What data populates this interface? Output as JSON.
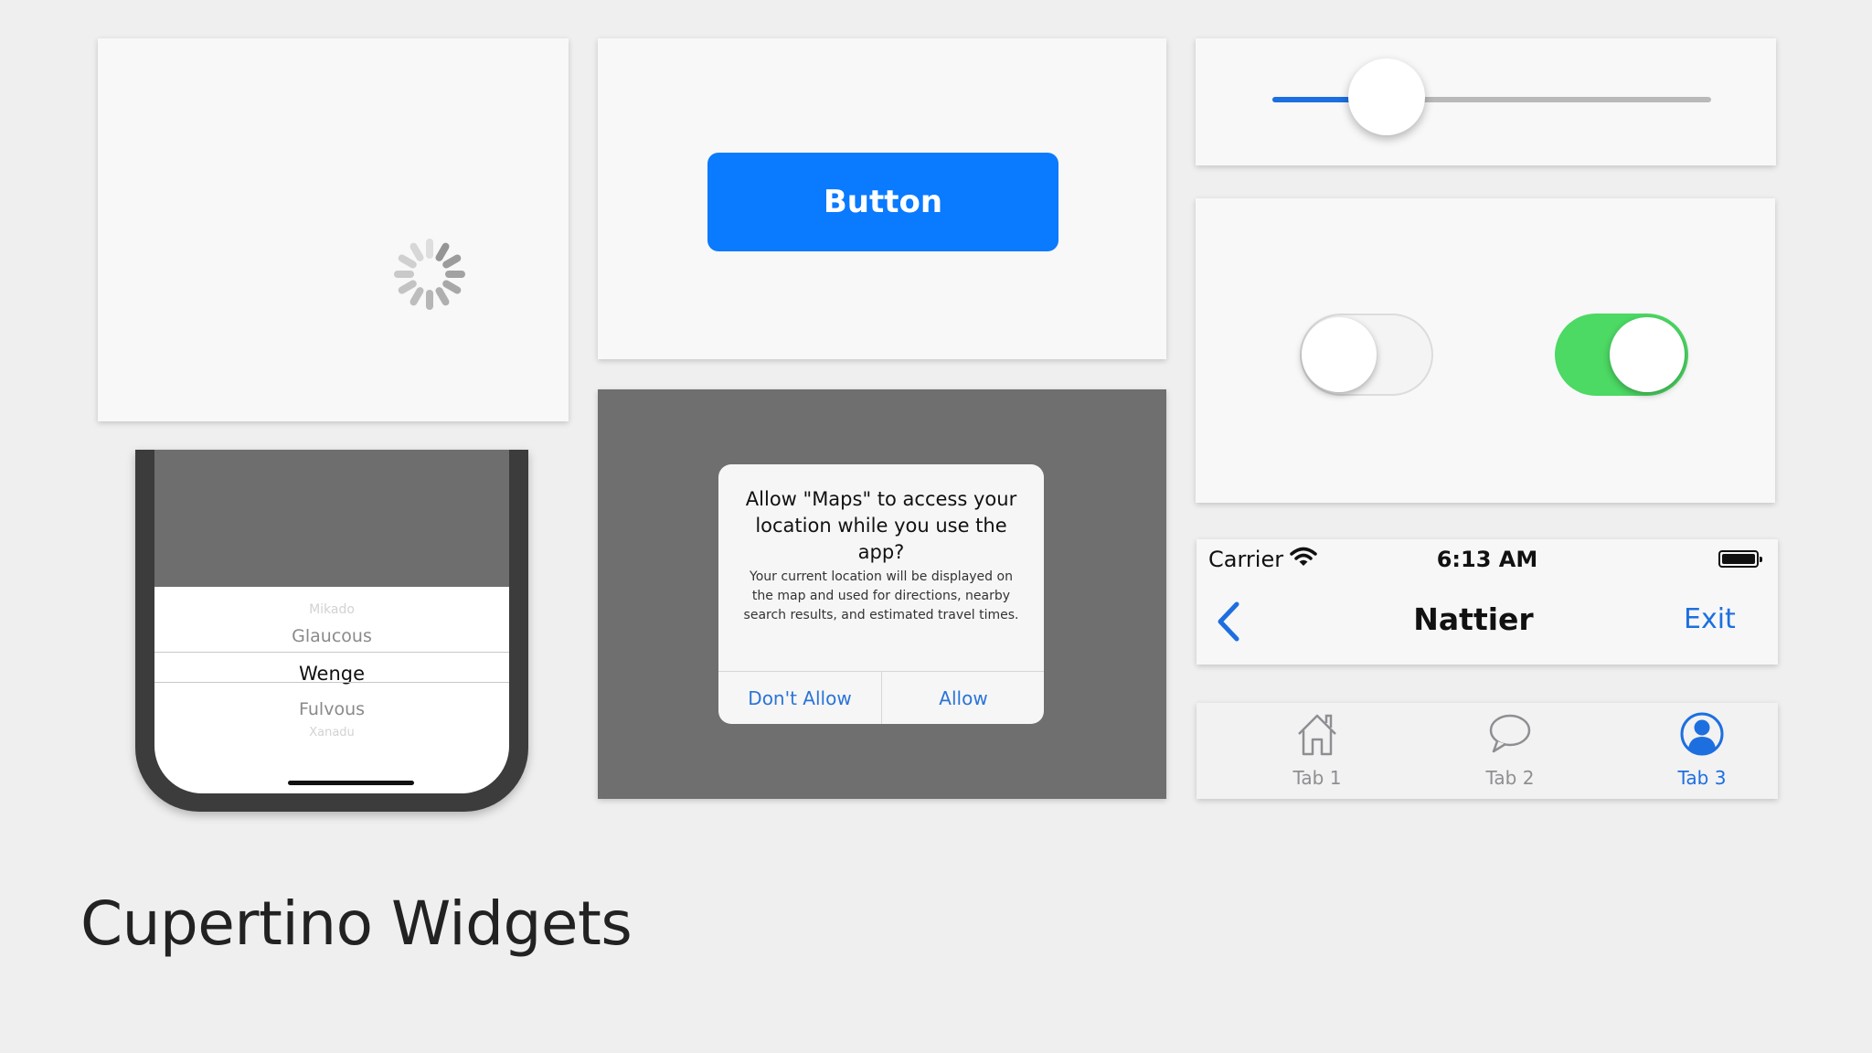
{
  "page": {
    "title": "Cupertino Widgets"
  },
  "activity_indicator": {
    "tick_count": 12
  },
  "button": {
    "label": "Button",
    "color": "#0a7aff"
  },
  "slider": {
    "value": 0.26,
    "active_color": "#1b6fe0",
    "inactive_color": "#b9b9b9"
  },
  "switches": [
    {
      "name": "switch-off",
      "on": false
    },
    {
      "name": "switch-on",
      "on": true,
      "color": "#4cd964"
    }
  ],
  "picker": {
    "items": [
      "Mikado",
      "Glaucous",
      "Wenge",
      "Fulvous",
      "Xanadu"
    ],
    "selected": "Wenge"
  },
  "alert": {
    "title": "Allow \"Maps\" to access your location while you use the app?",
    "message": "Your current location will be displayed on the map and used for directions, nearby search results, and estimated travel times.",
    "cancel_label": "Don't Allow",
    "confirm_label": "Allow",
    "action_color": "#2a74d8"
  },
  "nav_bar": {
    "carrier": "Carrier",
    "time": "6:13 AM",
    "title": "Nattier",
    "trailing_label": "Exit",
    "back_icon": "chevron-left-icon",
    "tint": "#1d6fe0"
  },
  "tab_bar": {
    "tabs": [
      {
        "label": "Tab 1",
        "icon": "house-icon",
        "active": false
      },
      {
        "label": "Tab 2",
        "icon": "chat-bubble-icon",
        "active": false
      },
      {
        "label": "Tab 3",
        "icon": "person-circle-icon",
        "active": true
      }
    ],
    "active_color": "#1d6fe0",
    "inactive_color": "#8e8e93"
  }
}
